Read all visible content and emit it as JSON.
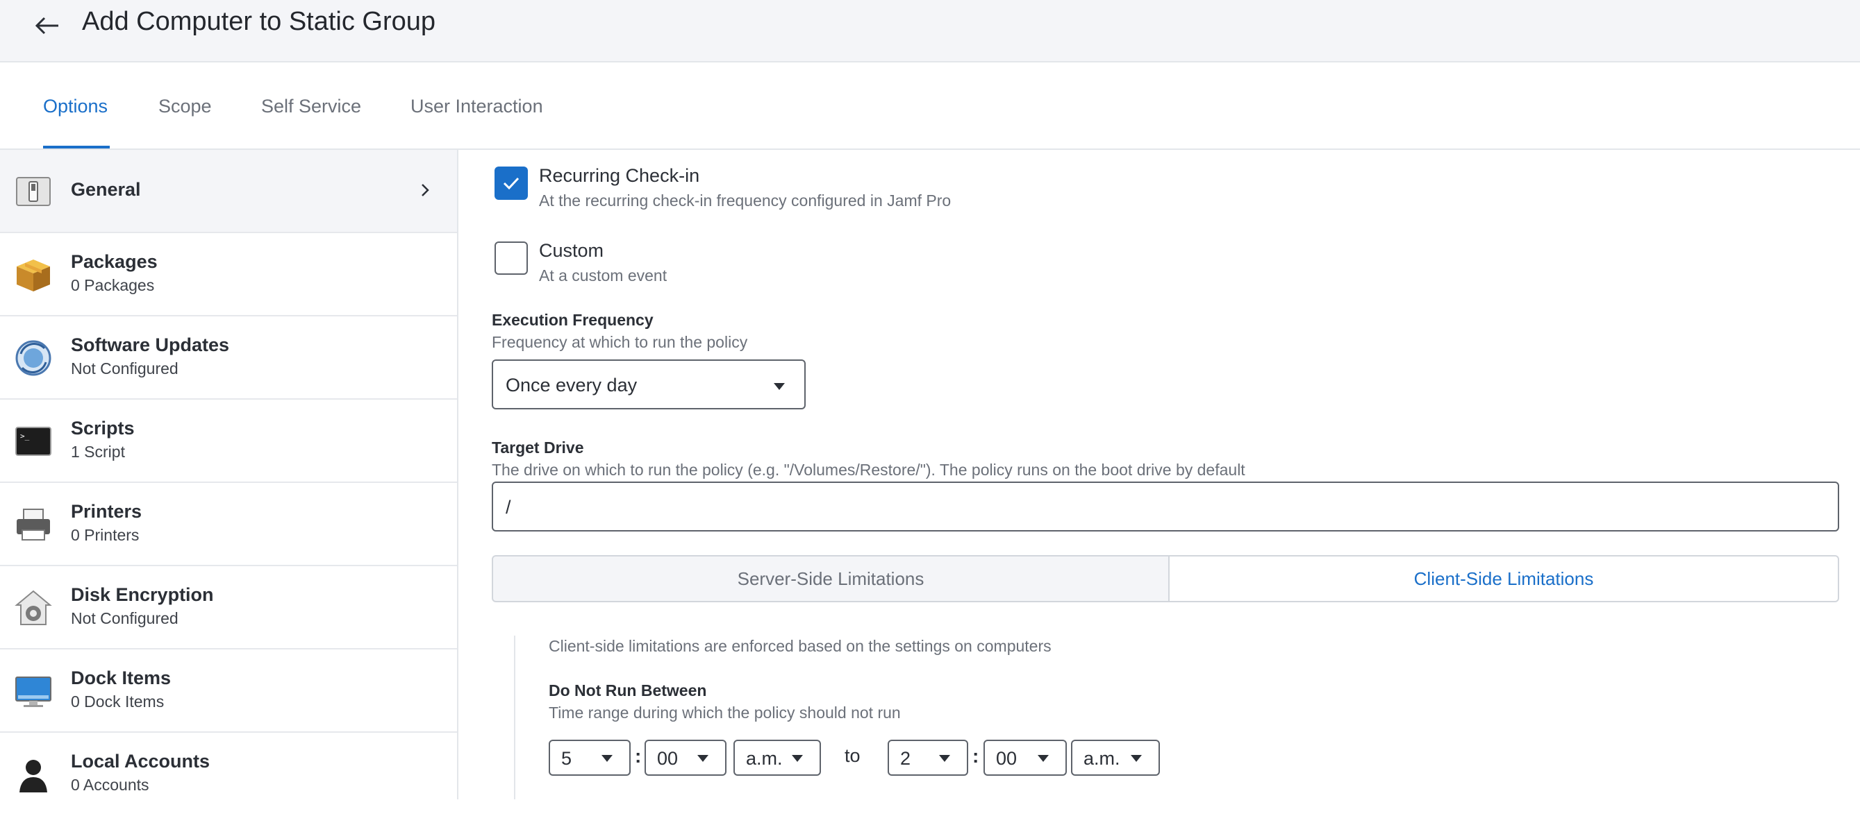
{
  "header": {
    "title": "Add Computer to Static Group"
  },
  "tabs": [
    {
      "label": "Options"
    },
    {
      "label": "Scope"
    },
    {
      "label": "Self Service"
    },
    {
      "label": "User Interaction"
    }
  ],
  "sidebar": {
    "items": [
      {
        "title": "General",
        "subtitle": "",
        "icon": "switch-icon"
      },
      {
        "title": "Packages",
        "subtitle": "0 Packages",
        "icon": "package-icon"
      },
      {
        "title": "Software Updates",
        "subtitle": "Not Configured",
        "icon": "software-update-icon"
      },
      {
        "title": "Scripts",
        "subtitle": "1 Script",
        "icon": "terminal-icon"
      },
      {
        "title": "Printers",
        "subtitle": "0 Printers",
        "icon": "printer-icon"
      },
      {
        "title": "Disk Encryption",
        "subtitle": "Not Configured",
        "icon": "disk-encryption-icon"
      },
      {
        "title": "Dock Items",
        "subtitle": "0 Dock Items",
        "icon": "monitor-icon"
      },
      {
        "title": "Local Accounts",
        "subtitle": "0 Accounts",
        "icon": "user-silhouette-icon"
      }
    ]
  },
  "triggers": {
    "recurring": {
      "label": "Recurring Check-in",
      "description": "At the recurring check-in frequency configured in Jamf Pro",
      "checked": true
    },
    "custom": {
      "label": "Custom",
      "description": "At a custom event",
      "checked": false
    }
  },
  "execution_frequency": {
    "title": "Execution Frequency",
    "description": "Frequency at which to run the policy",
    "value": "Once every day"
  },
  "target_drive": {
    "title": "Target Drive",
    "description": "The drive on which to run the policy (e.g. \"/Volumes/Restore/\"). The policy runs on the boot drive by default",
    "value": "/"
  },
  "limitations": {
    "server_label": "Server-Side Limitations",
    "client_label": "Client-Side Limitations",
    "active": "client",
    "client_description": "Client-side limitations are enforced based on the settings on computers",
    "do_not_run": {
      "title": "Do Not Run Between",
      "description": "Time range during which the policy should not run",
      "start_hour": "5",
      "start_minute": "00",
      "start_period": "a.m.",
      "to_label": "to",
      "end_hour": "2",
      "end_minute": "00",
      "end_period": "a.m."
    }
  },
  "colors": {
    "accent": "#1a6fc9",
    "header_bg": "#f4f5f8",
    "border": "#e3e6ea"
  }
}
